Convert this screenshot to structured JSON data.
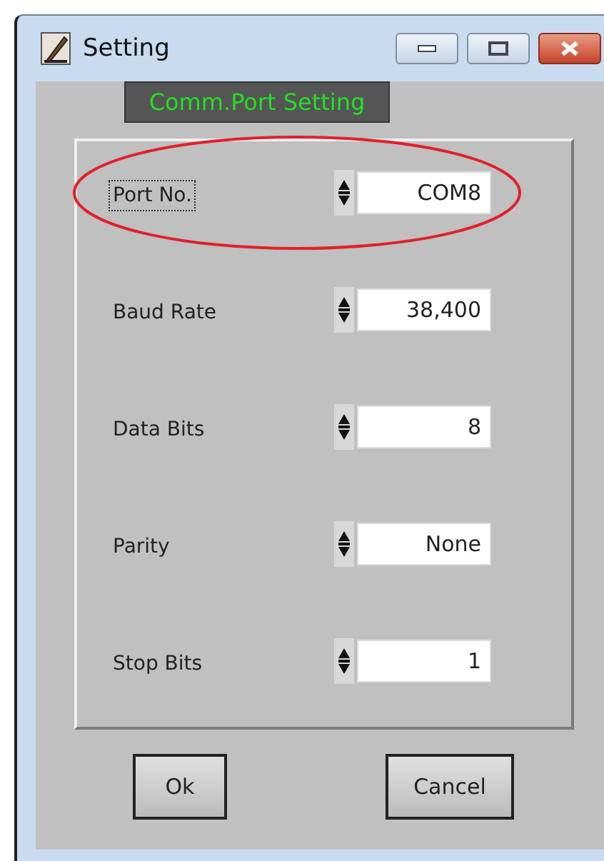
{
  "window": {
    "title": "Setting"
  },
  "group_title": "Comm.Port Setting",
  "settings": [
    {
      "label": "Port No.",
      "value": "COM8",
      "highlighted": true,
      "focused": true
    },
    {
      "label": "Baud Rate",
      "value": "38,400",
      "highlighted": false,
      "focused": false
    },
    {
      "label": "Data Bits",
      "value": "8",
      "highlighted": false,
      "focused": false
    },
    {
      "label": "Parity",
      "value": "None",
      "highlighted": false,
      "focused": false
    },
    {
      "label": "Stop Bits",
      "value": "1",
      "highlighted": false,
      "focused": false
    }
  ],
  "buttons": [
    "Ok",
    "Cancel"
  ]
}
